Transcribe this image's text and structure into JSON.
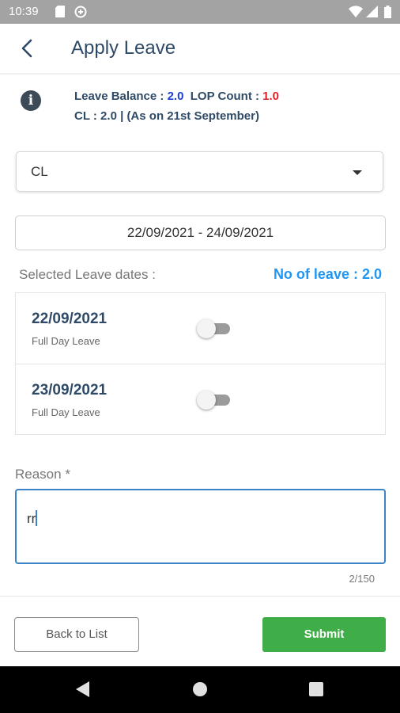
{
  "status_bar": {
    "time": "10:39"
  },
  "header": {
    "title": "Apply Leave"
  },
  "balance": {
    "leave_balance_label": "Leave Balance : ",
    "leave_balance_value": "2.0",
    "lop_label": "LOP Count : ",
    "lop_value": "1.0",
    "cl_line": "CL : 2.0 | (As on 21st September)"
  },
  "leave_type": {
    "selected": "CL"
  },
  "date_range": "22/09/2021 - 24/09/2021",
  "selected_dates": {
    "label": "Selected Leave dates :",
    "count_text": "No of leave : 2.0",
    "items": [
      {
        "date": "22/09/2021",
        "type": "Full Day Leave",
        "toggle": false
      },
      {
        "date": "23/09/2021",
        "type": "Full Day Leave",
        "toggle": false
      }
    ]
  },
  "reason": {
    "label": "Reason *",
    "value": "rr",
    "counter": "2/150"
  },
  "buttons": {
    "back": "Back to List",
    "submit": "Submit"
  },
  "colors": {
    "accent_blue": "#2196f3",
    "submit_green": "#3fae49",
    "lop_red": "#e0202b",
    "balance_blue": "#1a3fd6"
  }
}
